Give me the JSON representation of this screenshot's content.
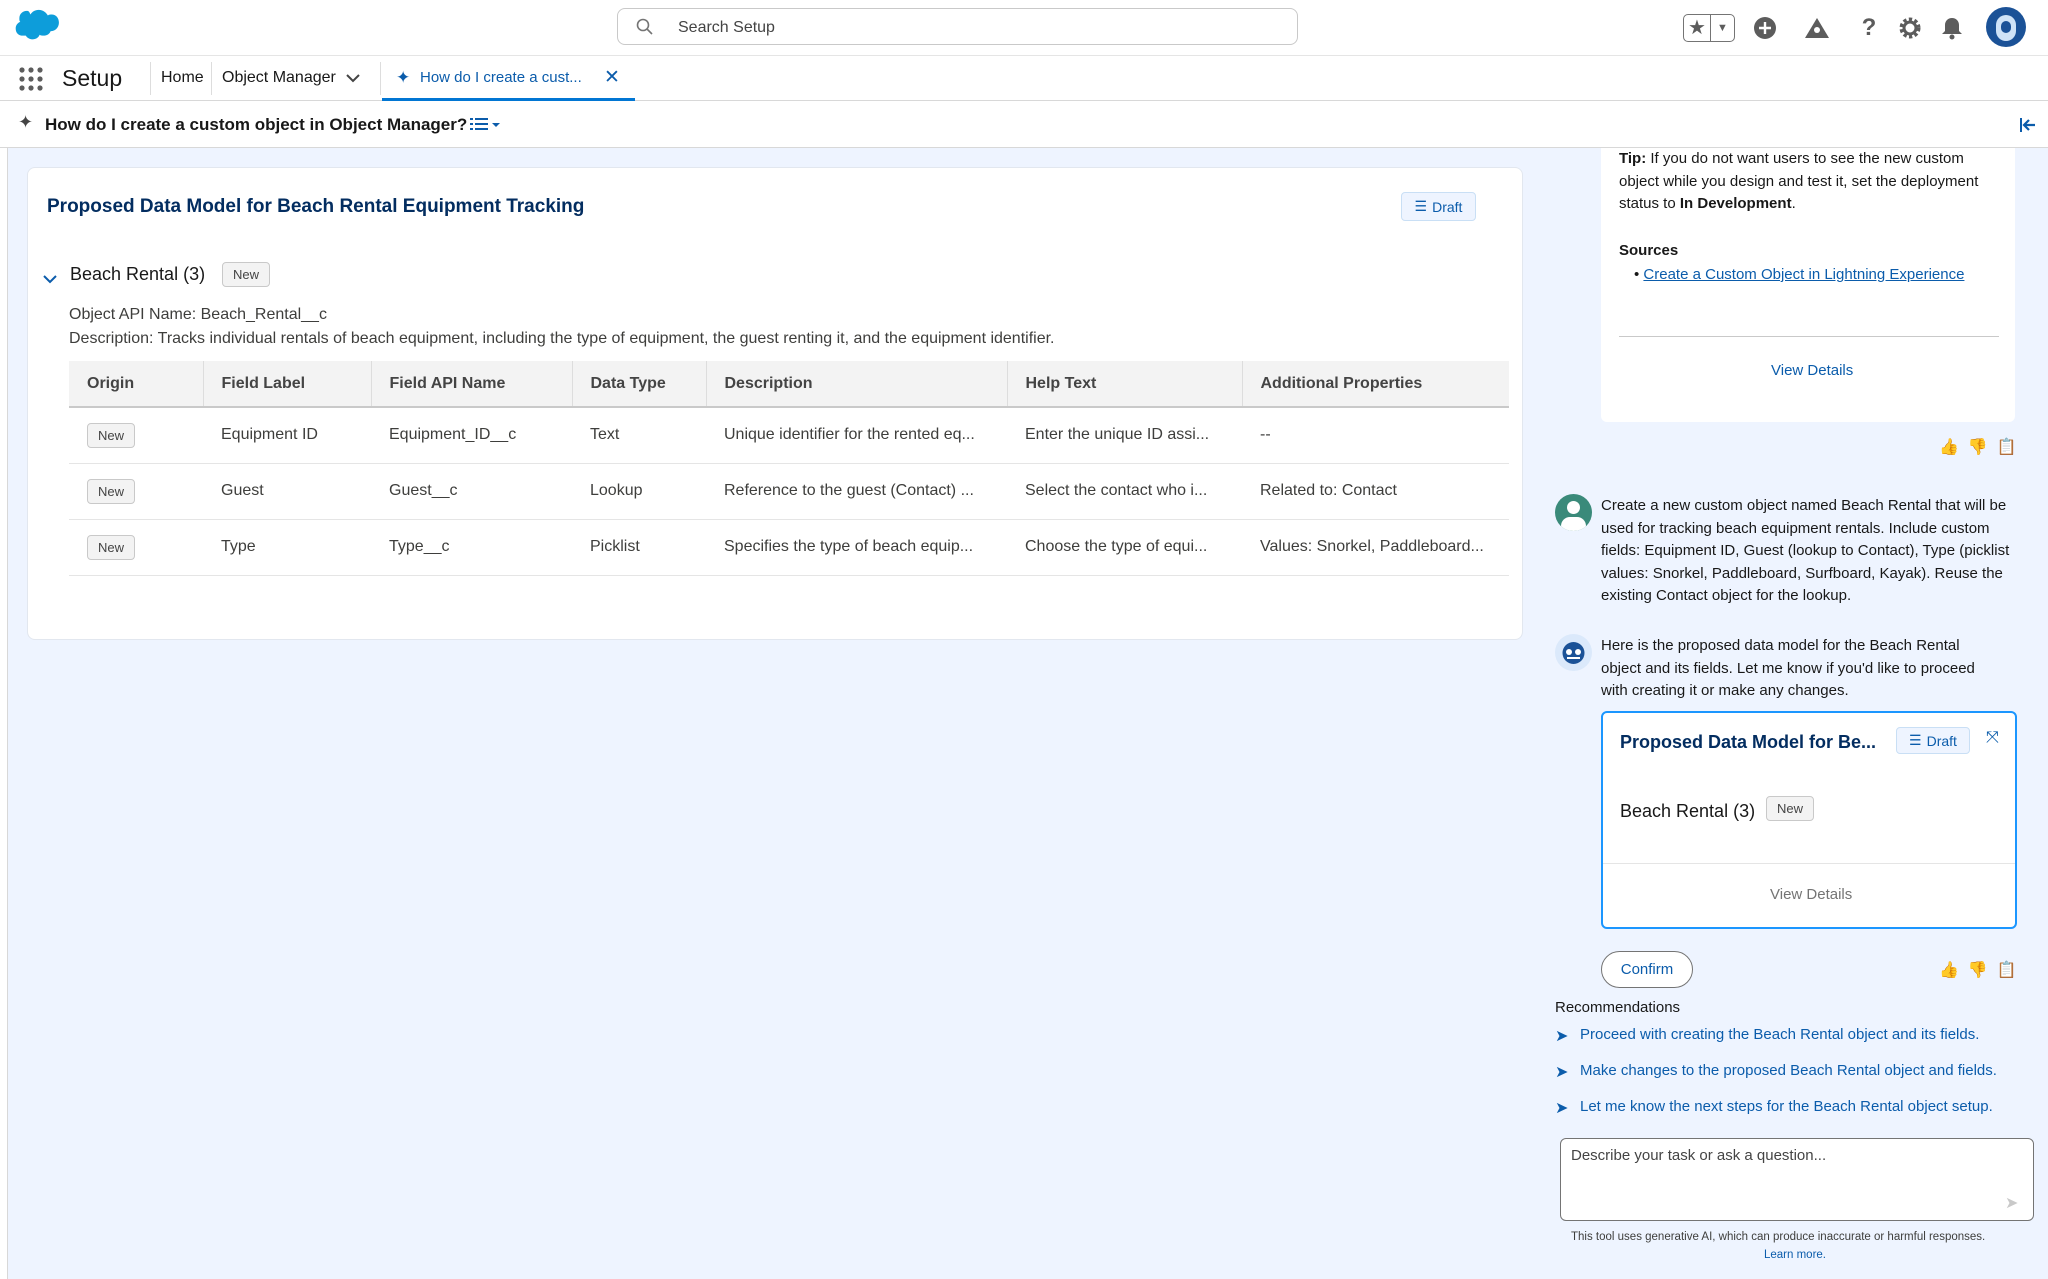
{
  "header": {
    "search_placeholder": "Search Setup"
  },
  "nav": {
    "app_name": "Setup",
    "tabs": [
      {
        "label": "Home"
      },
      {
        "label": "Object Manager"
      },
      {
        "label": "How do I create a cust..."
      }
    ]
  },
  "subheader": {
    "title": "How do I create a custom object in Object Manager?"
  },
  "proposal": {
    "title": "Proposed Data Model for Beach Rental Equipment Tracking",
    "draft_label": "Draft",
    "object_name": "Beach Rental (3)",
    "new_badge": "New",
    "api_name_label": "Object API Name:",
    "api_name_value": "Beach_Rental__c",
    "description_label": "Description:",
    "description_value": "Tracks individual rentals of beach equipment, including the type of equipment, the guest renting it, and the equipment identifier.",
    "columns": [
      "Origin",
      "Field Label",
      "Field API Name",
      "Data Type",
      "Description",
      "Help Text",
      "Additional Properties"
    ],
    "rows": [
      {
        "origin": "New",
        "label": "Equipment ID",
        "api": "Equipment_ID__c",
        "type": "Text",
        "desc": "Unique identifier for the rented eq...",
        "help": "Enter the unique ID assi...",
        "props": "--"
      },
      {
        "origin": "New",
        "label": "Guest",
        "api": "Guest__c",
        "type": "Lookup",
        "desc": "Reference to the guest (Contact) ...",
        "help": "Select the contact who i...",
        "props": "Related to: Contact"
      },
      {
        "origin": "New",
        "label": "Type",
        "api": "Type__c",
        "type": "Picklist",
        "desc": "Specifies the type of beach equip...",
        "help": "Choose the type of equi...",
        "props": "Values: Snorkel, Paddleboard..."
      }
    ]
  },
  "chat": {
    "tip_bold": "Tip:",
    "tip_line1": "If you do not want users to see the new custom",
    "tip_line2": "object while you design and test it, set the deployment",
    "tip_line3_pre": "status to",
    "tip_line3_bold": "In Development",
    "tip_line3_post": ".",
    "sources_label": "Sources",
    "source_link": "Create a Custom Object in Lightning Experience",
    "view_details": "View Details",
    "user_msg": [
      "Create a new custom object named Beach Rental that will be",
      "used for tracking beach equipment rentals. Include custom",
      "fields: Equipment ID, Guest (lookup to Contact), Type (picklist",
      "values: Snorkel, Paddleboard, Surfboard, Kayak). Reuse the",
      "existing Contact object for the lookup."
    ],
    "bot_msg": [
      "Here is the proposed data model for the Beach Rental",
      "object and its fields. Let me know if you'd like to proceed",
      "with creating it or make any changes."
    ],
    "mini_title": "Proposed Data Model for Be...",
    "mini_draft": "Draft",
    "mini_object": "Beach Rental (3)",
    "mini_new": "New",
    "mini_view_details": "View Details",
    "confirm": "Confirm",
    "recommendations_label": "Recommendations",
    "recommendations": [
      "Proceed with creating the Beach Rental object and its fields.",
      "Make changes to the proposed Beach Rental object and fields.",
      "Let me know the next steps for the Beach Rental object setup."
    ],
    "input_placeholder": "Describe your task or ask a question...",
    "disclaimer": "This tool uses generative AI, which can produce inaccurate or harmful responses.",
    "learn_more": "Learn more."
  }
}
